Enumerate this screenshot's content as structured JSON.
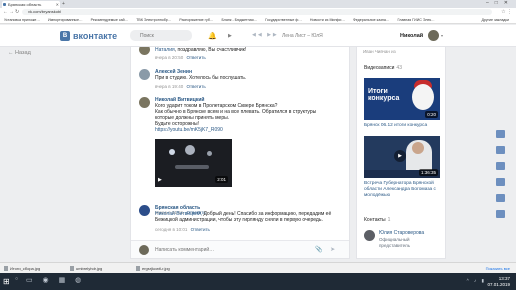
{
  "browser": {
    "tab_title": "Брянская область",
    "url": "vk.com/bryanskobl",
    "bookmarks": [
      "Установка приложе…",
      "Импортированные…",
      "Рекомендуемые сай…",
      "ТВК Электроннобр…",
      "Распоряжение губ…",
      "Бланк - Бюджетная…",
      "Государственные ф…",
      "Новости из Минфи…",
      "Федеральное казна…",
      "Главная ГИИС Элек…"
    ],
    "bookmarks_right": "Другие закладки"
  },
  "vk_header": {
    "logo_text": "вконтакте",
    "search_placeholder": "Поиск",
    "now_playing": "Лена Лист – ЮлЯ",
    "user_name": "Николай"
  },
  "back_link": "Назад",
  "feed": {
    "comments": [
      {
        "author": "Наталия",
        "text": "поздравляю, Вы счастливчик!",
        "time": "вчера в 20:50",
        "reply": "Ответить"
      },
      {
        "author": "Алексей Зенин",
        "text": "При в студию. Хотелось бы послушать.",
        "time": "вчера в 19:40",
        "reply": "Ответить"
      },
      {
        "author": "Николай Витвицкий",
        "lines": [
          "Кого ударит током в Пролетарском Сквере Брянска?",
          "Как обычно в Брянске всем и на все плевать. Обратился в структуры",
          "которые должны принять меры.",
          "Будьте осторожны!"
        ],
        "link": "https://youtu.be/mK5jK7_R090",
        "video_duration": "2:01",
        "time": "вчера в 21:51",
        "reply": "Ответить"
      },
      {
        "author": "Брянская область",
        "addressee": "Николай Витвицкий,",
        "lines": [
          "Добрый день! Спасибо за информацию, передадим её",
          "Бежицкой администрации, чтобы эту гирлянду сняли в первую очередь."
        ],
        "time": "сегодня в 10:01",
        "reply": "Ответить"
      }
    ],
    "write_placeholder": "Написать комментарий…"
  },
  "sidebar": {
    "top_text": "Иван Чивчан из",
    "videos_title": "Видеозаписи",
    "videos_count": "43",
    "video1": {
      "overlay": "Итоги конкурса",
      "duration": "0:20",
      "caption": "Брянск 06.12 итоги конкурса"
    },
    "video2": {
      "duration": "1:36:35",
      "caption": "Встреча Губернатора Брянской области Александра Богомаза с молодёжью"
    },
    "contacts_title": "Контакты",
    "contacts_count": "1",
    "contact": {
      "name": "Юлия Староверова",
      "role": "Официальный представитель"
    }
  },
  "downloads": [
    "Итоги_сбора.jpg",
    "umbrelyhdr.jpg",
    "ergsrjkcwtl-r.jpg"
  ],
  "downloads_all": "Показать все",
  "clock": {
    "time": "13:37",
    "date": "07.01.2019"
  }
}
